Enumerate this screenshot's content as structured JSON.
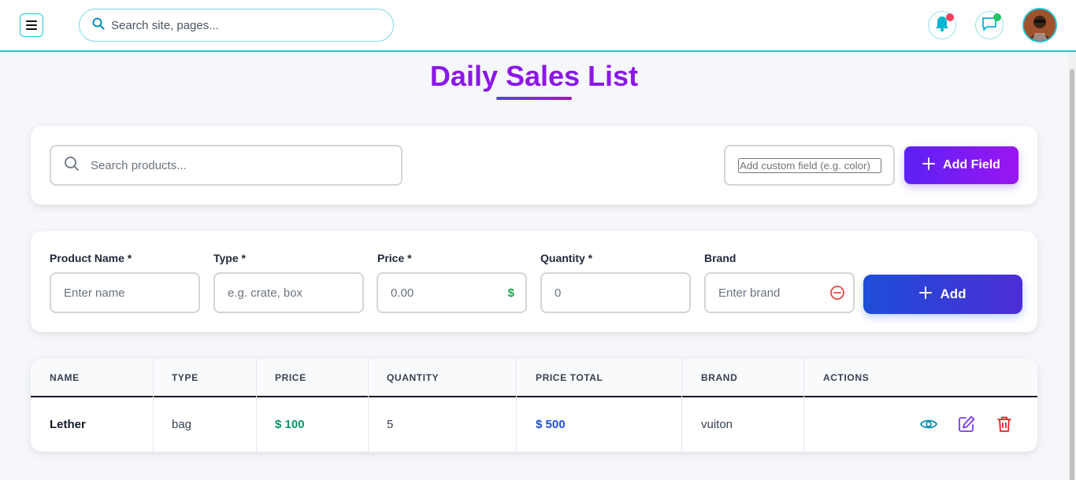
{
  "topbar": {
    "search_placeholder": "Search site, pages...",
    "notification_dot_color": "#f43f5e",
    "message_dot_color": "#22c55e",
    "accent": "#22c3d6"
  },
  "page": {
    "title": "Daily Sales List"
  },
  "search_card": {
    "search_placeholder": "Search products...",
    "custom_field_placeholder": "Add custom field (e.g. color)",
    "add_field_label": "Add Field"
  },
  "form": {
    "product_name_label": "Product Name *",
    "product_name_placeholder": "Enter name",
    "type_label": "Type *",
    "type_placeholder": "e.g. crate, box",
    "price_label": "Price *",
    "price_placeholder": "0.00",
    "price_suffix": "$",
    "quantity_label": "Quantity *",
    "quantity_placeholder": "0",
    "brand_label": "Brand",
    "brand_placeholder": "Enter brand",
    "add_label": "Add"
  },
  "table": {
    "columns": [
      "NAME",
      "TYPE",
      "PRICE",
      "QUANTITY",
      "PRICE TOTAL",
      "BRAND",
      "ACTIONS"
    ],
    "rows": [
      {
        "name": "Lether",
        "type": "bag",
        "price": "$ 100",
        "quantity": "5",
        "price_total": "$ 500",
        "brand": "vuiton"
      }
    ]
  }
}
